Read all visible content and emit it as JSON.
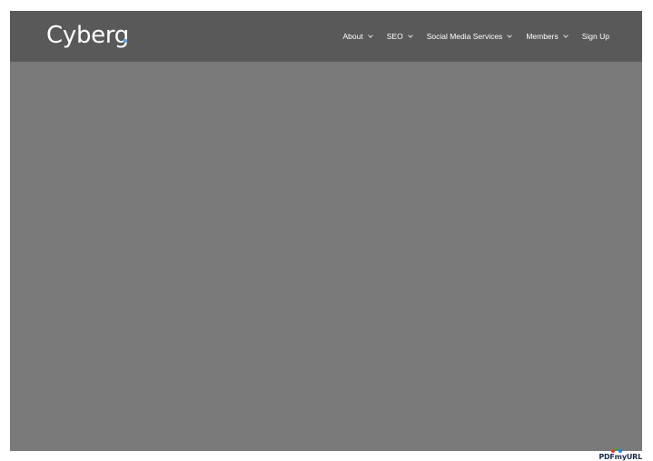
{
  "header": {
    "logo_text": "Cyberg"
  },
  "nav": {
    "items": [
      {
        "label": "About",
        "has_dropdown": true
      },
      {
        "label": "SEO",
        "has_dropdown": true
      },
      {
        "label": "Social Media Services",
        "has_dropdown": true
      },
      {
        "label": "Members",
        "has_dropdown": true
      },
      {
        "label": "Sign Up",
        "has_dropdown": false
      }
    ]
  },
  "watermark": {
    "text": "PDFmyURL"
  },
  "colors": {
    "header_bg": "#595959",
    "content_bg": "#7a7a7a",
    "nav_text": "#ffffff",
    "logo_accent": "#4aa3ff"
  }
}
